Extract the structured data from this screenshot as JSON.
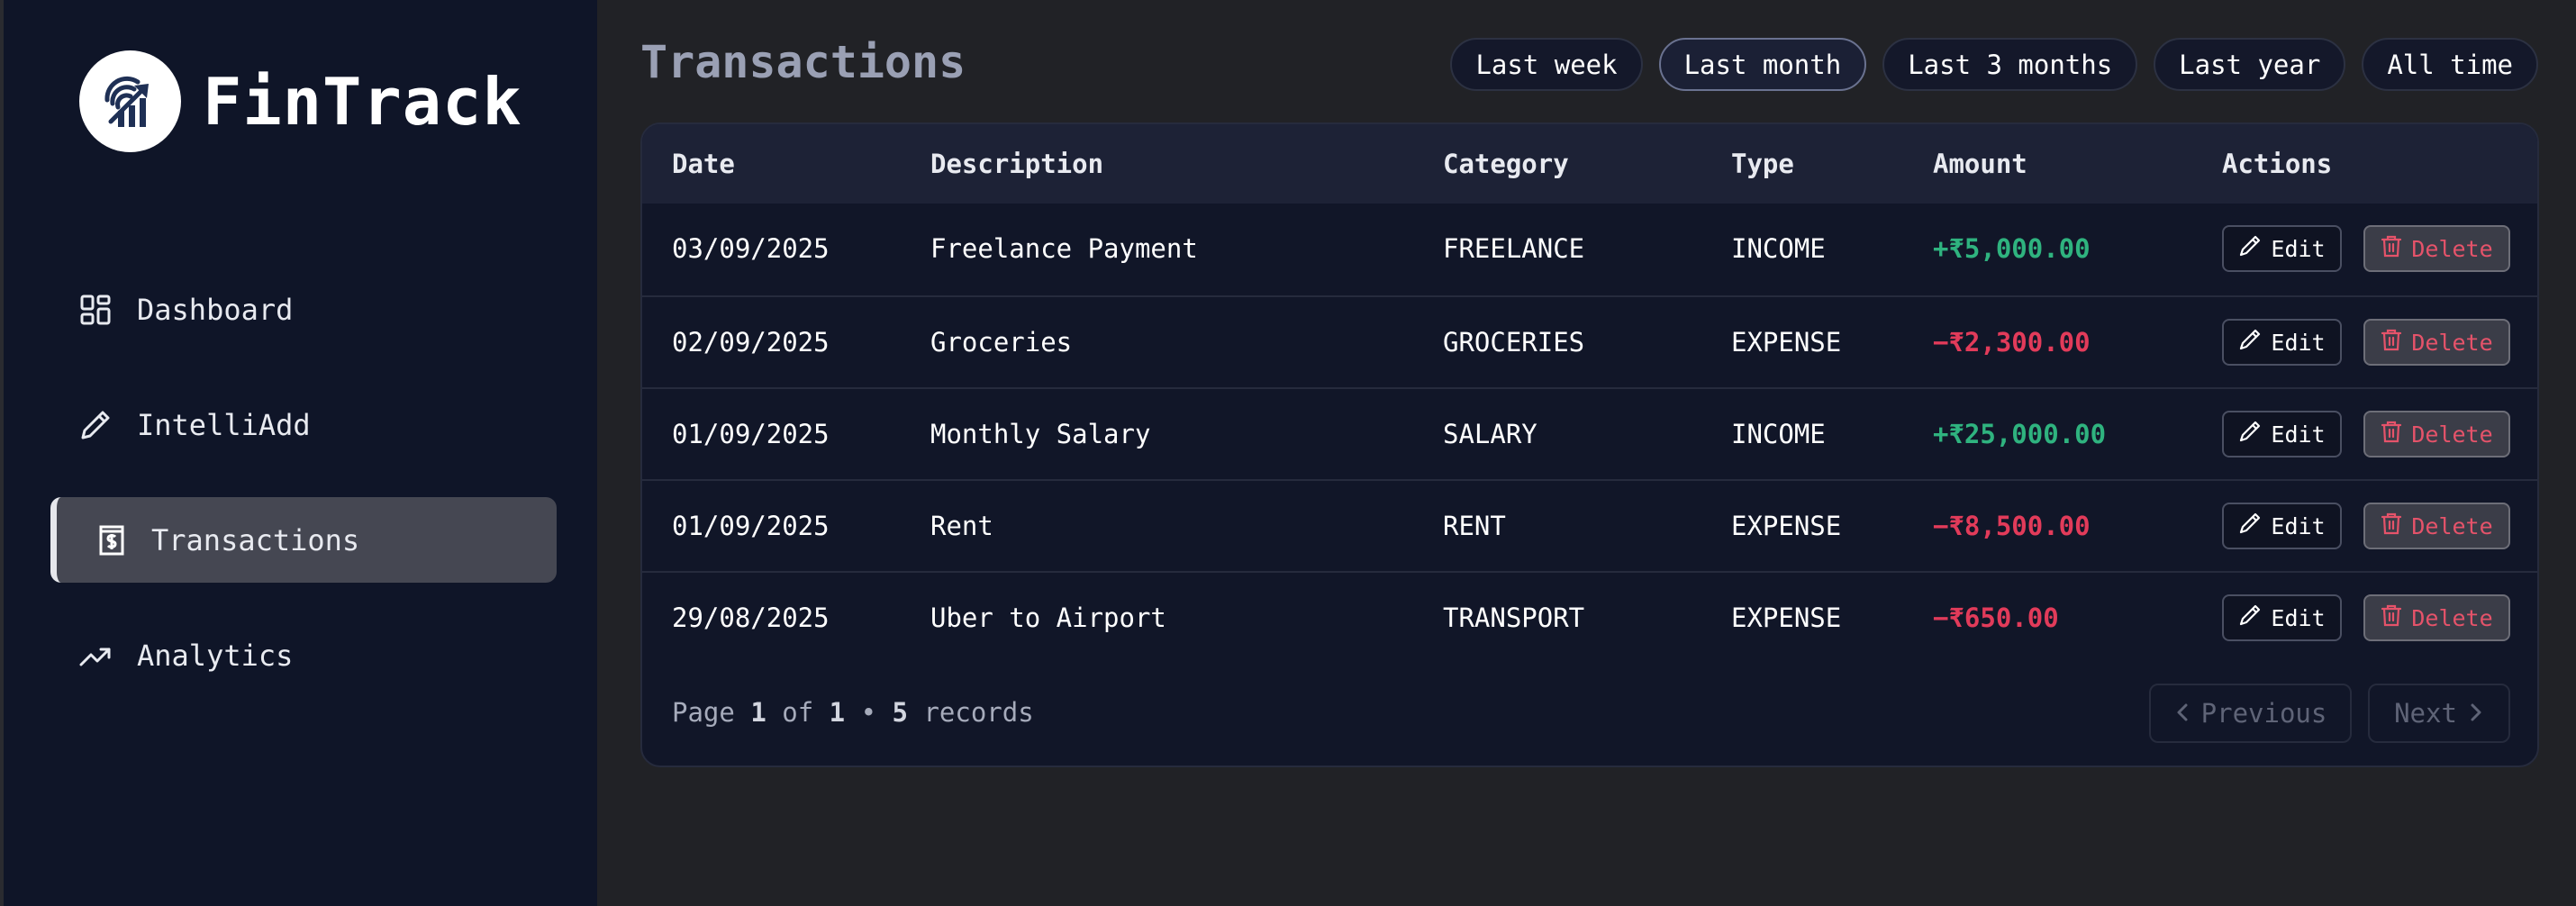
{
  "brand": {
    "name": "FinTrack",
    "logo_icon": "finance-graph-icon"
  },
  "sidebar": {
    "items": [
      {
        "label": "Dashboard",
        "icon": "dashboard-grid-icon",
        "active": false
      },
      {
        "label": "IntelliAdd",
        "icon": "pencil-icon",
        "active": false
      },
      {
        "label": "Transactions",
        "icon": "receipt-dollar-icon",
        "active": true
      },
      {
        "label": "Analytics",
        "icon": "trend-up-icon",
        "active": false
      }
    ]
  },
  "header": {
    "title": "Transactions",
    "filters": [
      {
        "label": "Last week",
        "selected": false
      },
      {
        "label": "Last month",
        "selected": true
      },
      {
        "label": "Last 3 months",
        "selected": false
      },
      {
        "label": "Last year",
        "selected": false
      },
      {
        "label": "All time",
        "selected": false
      }
    ]
  },
  "table": {
    "columns": [
      "Date",
      "Description",
      "Category",
      "Type",
      "Amount",
      "Actions"
    ],
    "rows": [
      {
        "date": "03/09/2025",
        "description": "Freelance Payment",
        "category": "FREELANCE",
        "type": "INCOME",
        "amount": "+₹5,000.00",
        "kind": "income"
      },
      {
        "date": "02/09/2025",
        "description": "Groceries",
        "category": "GROCERIES",
        "type": "EXPENSE",
        "amount": "−₹2,300.00",
        "kind": "expense"
      },
      {
        "date": "01/09/2025",
        "description": "Monthly Salary",
        "category": "SALARY",
        "type": "INCOME",
        "amount": "+₹25,000.00",
        "kind": "income"
      },
      {
        "date": "01/09/2025",
        "description": "Rent",
        "category": "RENT",
        "type": "EXPENSE",
        "amount": "−₹8,500.00",
        "kind": "expense"
      },
      {
        "date": "29/08/2025",
        "description": "Uber to Airport",
        "category": "TRANSPORT",
        "type": "EXPENSE",
        "amount": "−₹650.00",
        "kind": "expense"
      }
    ],
    "edit_label": "Edit",
    "delete_label": "Delete"
  },
  "pagination": {
    "page_word": "Page",
    "page": "1",
    "of_word": "of",
    "total_pages": "1",
    "separator": "•",
    "records": "5",
    "records_word": "records",
    "previous_label": "Previous",
    "next_label": "Next"
  },
  "colors": {
    "sidebar_bg": "#0f1528",
    "main_bg": "#212226",
    "income": "#2fb37f",
    "expense": "#e23b5a",
    "active_nav": "#454752"
  }
}
